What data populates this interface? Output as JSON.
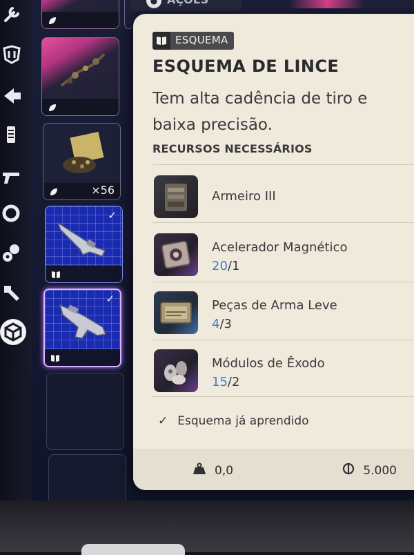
{
  "top_tab": {
    "label": "AÇÕES"
  },
  "inventory": {
    "stack_count": "×56"
  },
  "card": {
    "type_label": "ESQUEMA",
    "title": "ESQUEMA DE LINCE",
    "description": "Tem alta cadência de tiro e baixa precisão.",
    "resources_header": "RECURSOS NECESSÁRIOS",
    "resources": [
      {
        "name": "Armeiro III",
        "icon": "workbench-icon"
      },
      {
        "name": "Acelerador Magnético",
        "have": "20",
        "need": "/1",
        "icon": "magnetic-accelerator-icon"
      },
      {
        "name": "Peças de Arma Leve",
        "have": "4",
        "need": "/3",
        "icon": "light-gun-parts-icon"
      },
      {
        "name": "Módulos de Êxodo",
        "have": "15",
        "need": "/2",
        "icon": "exodus-modules-icon"
      }
    ],
    "learned_text": "Esquema já aprendido",
    "weight": "0,0",
    "price": "5.000"
  },
  "colors": {
    "card_bg": "#efeadb",
    "quantity_have": "#3c7fd4",
    "blueprint_slot": "#1a2bb0",
    "accent_pink": "#e74f9c"
  }
}
